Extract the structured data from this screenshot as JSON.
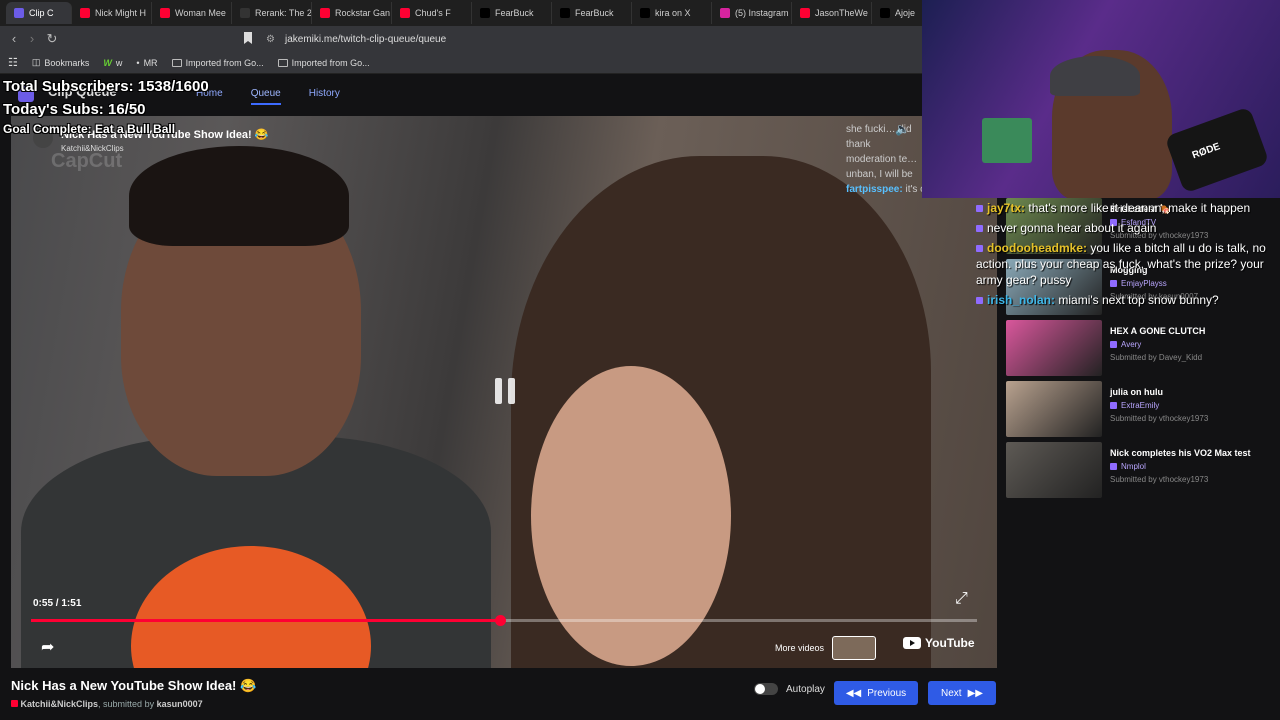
{
  "browser": {
    "tabs": [
      {
        "label": "Clip C",
        "color": "#6c5ce7",
        "active": true
      },
      {
        "label": "Nick Might H",
        "color": "#ff0033"
      },
      {
        "label": "Woman Mee",
        "color": "#ff0033"
      },
      {
        "label": "Rerank: The 2",
        "color": "#333333"
      },
      {
        "label": "Rockstar Gan",
        "color": "#ff0033"
      },
      {
        "label": "Chud's F",
        "color": "#ff0033"
      },
      {
        "label": "FearBuck",
        "color": "#000000"
      },
      {
        "label": "FearBuck",
        "color": "#000000"
      },
      {
        "label": "kira on X",
        "color": "#000000"
      },
      {
        "label": "(5) Instagram",
        "color": "#d6249f"
      },
      {
        "label": "JasonTheWe",
        "color": "#ff0033"
      },
      {
        "label": "Ajoje",
        "color": "#000000"
      }
    ],
    "url": "jakemiki.me/twitch-clip-queue/queue",
    "bookmarks": [
      "Bookmarks",
      "w",
      "MR",
      "Imported from Go...",
      "Imported from Go..."
    ]
  },
  "app": {
    "brand": "Clip Queue",
    "nav": [
      "Home",
      "Queue",
      "History"
    ],
    "active_nav": "Queue"
  },
  "video": {
    "title": "Nick Has a New YouTube Show Idea! 😂",
    "channel": "Katchii&NickClips",
    "watermark": "CapCut",
    "current_time": "0:55",
    "duration": "1:51",
    "progress": 0.4955,
    "more_videos": "More videos",
    "youtube_label": "YouTube",
    "chat_lines": [
      {
        "user": "",
        "text": "she fucki… did"
      },
      {
        "user": "",
        "text": "thank"
      },
      {
        "user": "",
        "text": "moderation te…"
      },
      {
        "user": "",
        "text": "unban, I will be"
      },
      {
        "user": "fartpisspee:",
        "text": "it's ok"
      }
    ]
  },
  "clip": {
    "title": "Nick Has a New YouTube Show Idea! 😂",
    "channel": "Katchii&NickClips",
    "submitted_prefix": ", submitted by",
    "submitter": "kasun0007",
    "autoplay_label": "Autoplay",
    "autoplay": false,
    "previous_label": "Previous",
    "next_label": "Next"
  },
  "queue": [
    {
      "title": "Brisketfest 🍖",
      "channel": "EsfandTV",
      "submitter": "Submitted by vthockey1973",
      "color": "#6e8a4f"
    },
    {
      "title": "Mogging",
      "channel": "EmjayPlayss",
      "submitter": "Submitted by kasun0007",
      "color": "#8aa9b8"
    },
    {
      "title": "HEX A GONE CLUTCH",
      "channel": "Avery",
      "submitter": "Submitted by Davey_Kidd",
      "color": "#d9579c"
    },
    {
      "title": "julia on hulu",
      "channel": "ExtraEmily",
      "submitter": "Submitted by vthockey1973",
      "color": "#b9a28f"
    },
    {
      "title": "Nick completes his VO2 Max test",
      "channel": "Nmplol",
      "submitter": "Submitted by vthockey1973",
      "color": "#5e5a55"
    }
  ],
  "overlay": {
    "subs_total": "Total Subscribers: 1538/1600",
    "subs_today": "Today's Subs: 16/50",
    "goal": "Goal Complete: Eat a Bull Ball"
  },
  "webcam": {
    "mic_brand": "RØDE"
  },
  "twitch_chat": [
    {
      "user": "jay7tx:",
      "color": "#e6c229",
      "text": "that's more like it deannn, make it happen"
    },
    {
      "user": "",
      "color": "#ff3b3b",
      "text": "never gonna hear about it again"
    },
    {
      "user": "doodooheadmke:",
      "color": "#e6c229",
      "text": "you like a bitch all u do is talk, no action. plus your cheap as fuck, what's the prize? your army gear? pussy"
    },
    {
      "user": "irish_nolan:",
      "color": "#3fb7e8",
      "text": "miami's next top snow bunny?"
    }
  ]
}
